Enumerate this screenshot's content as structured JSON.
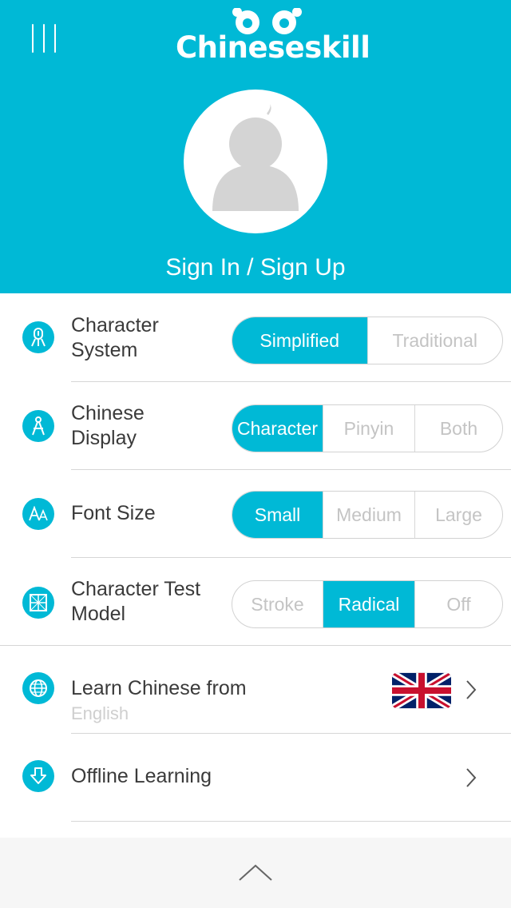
{
  "header": {
    "brand": "Chineseskill",
    "sign_in": "Sign In / Sign Up",
    "accent": "#00b9d6"
  },
  "settings": {
    "character_system": {
      "label_line1": "Character",
      "label_line2": "System",
      "options": [
        "Simplified",
        "Traditional"
      ],
      "selected": "Simplified"
    },
    "chinese_display": {
      "label_line1": "Chinese",
      "label_line2": "Display",
      "options": [
        "Character",
        "Pinyin",
        "Both"
      ],
      "selected": "Character"
    },
    "font_size": {
      "label": "Font Size",
      "options": [
        "Small",
        "Medium",
        "Large"
      ],
      "selected": "Small"
    },
    "character_test_model": {
      "label_line1": "Character Test",
      "label_line2": "Model",
      "options": [
        "Stroke",
        "Radical",
        "Off"
      ],
      "selected": "Radical"
    },
    "learn_from": {
      "label": "Learn Chinese from",
      "value": "English",
      "flag": "uk-flag-icon"
    },
    "offline": {
      "label": "Offline Learning"
    }
  },
  "icons": {
    "menu": "menu-icon",
    "character_system": "brush-icon",
    "chinese_display": "compass-icon",
    "font_size": "font-size-icon",
    "character_test": "grid-icon",
    "learn_from": "globe-icon",
    "offline": "download-icon",
    "chevron": "chevron-right-icon",
    "collapse": "chevron-up-icon"
  }
}
